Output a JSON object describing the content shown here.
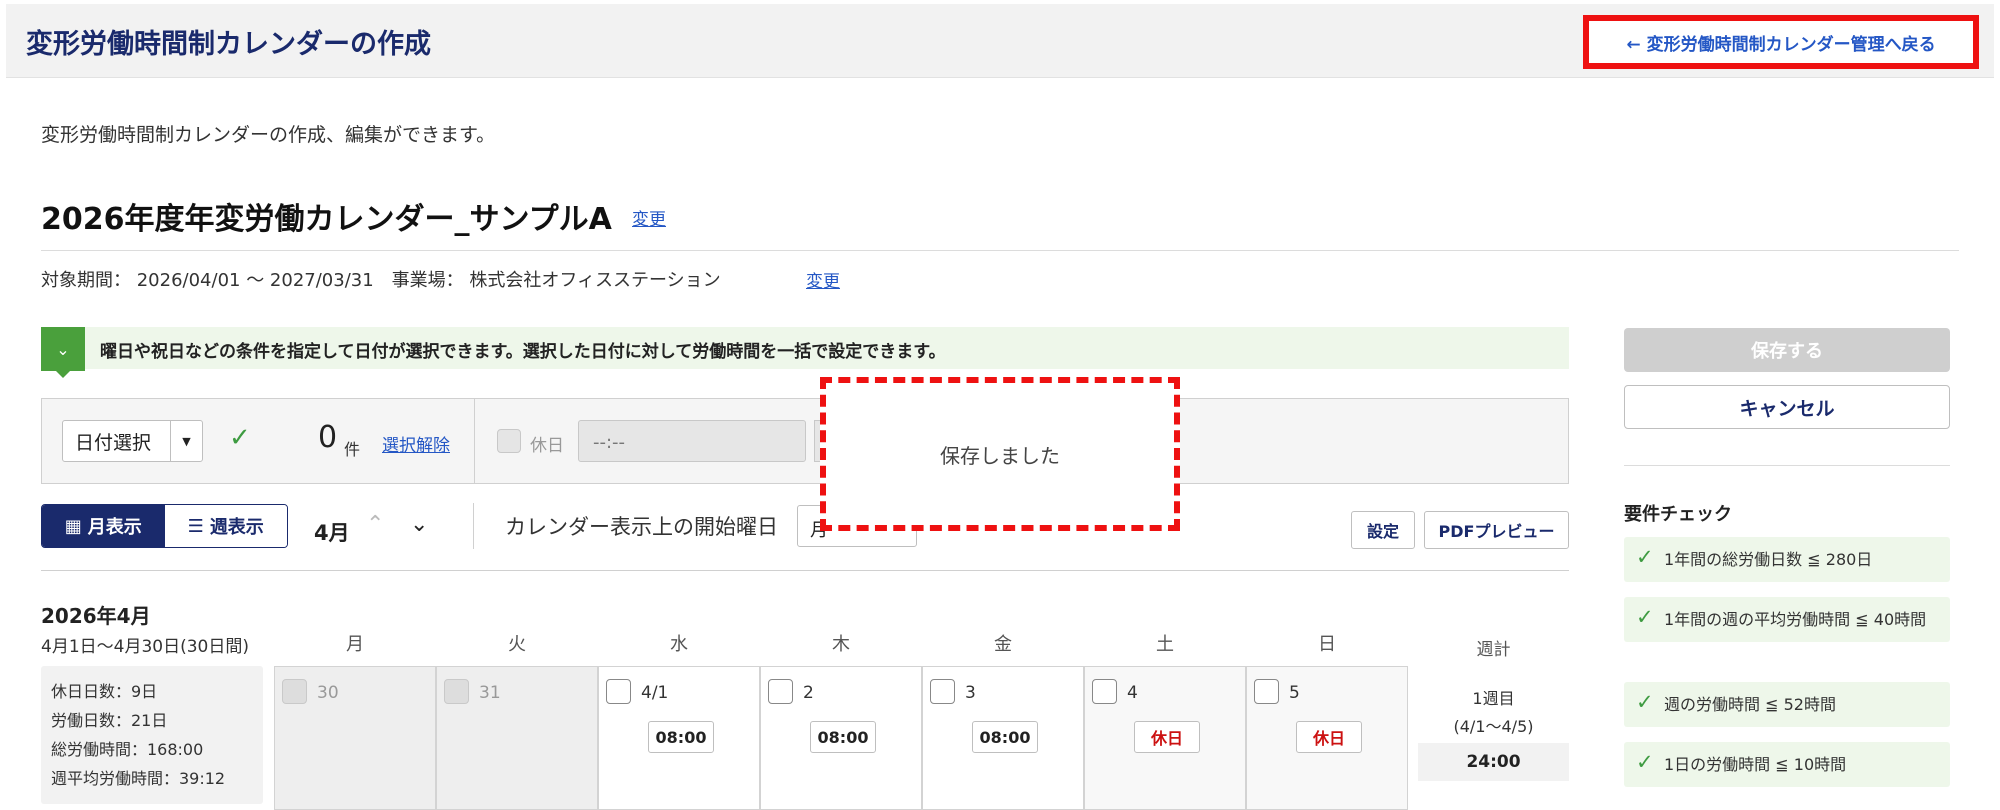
{
  "header": {
    "title": "変形労働時間制カレンダーの作成",
    "back_link": "← 変形労働時間制カレンダー管理へ戻る"
  },
  "description": "変形労働時間制カレンダーの作成、編集ができます。",
  "calendar": {
    "name": "2026年度年変労働カレンダー_サンプルA",
    "change_label": "変更",
    "period_text": "対象期間： 2026/04/01 ～ 2027/03/31　事業場： 株式会社オフィスステーション",
    "period_change_label": "変更"
  },
  "notice": {
    "text": "曜日や祝日などの条件を指定して日付が選択できます。選択した日付に対して労働時間を一括で設定できます。"
  },
  "toolbar": {
    "date_select": "日付選択",
    "count": "0",
    "count_unit": "件",
    "deselect": "選択解除",
    "holiday_label": "休日",
    "time_value": "--:--"
  },
  "view": {
    "month_label": "月表示",
    "week_label": "週表示",
    "current_month": "4月",
    "start_day_label": "カレンダー表示上の開始曜日",
    "start_day_value": "月",
    "settings": "設定",
    "pdf_preview": "PDFプレビュー"
  },
  "month": {
    "title": "2026年4月",
    "range": "4月1日～4月30日(30日間)",
    "stats": [
      "休日日数：9日",
      "労働日数：21日",
      "総労働時間：168:00",
      "週平均労働時間：39:12"
    ]
  },
  "weekdays": [
    "月",
    "火",
    "水",
    "木",
    "金",
    "土",
    "日"
  ],
  "week_total_header": "週計",
  "week1": {
    "days": [
      {
        "num": "30",
        "tag": ""
      },
      {
        "num": "31",
        "tag": ""
      },
      {
        "num": "4/1",
        "tag": "08:00"
      },
      {
        "num": "2",
        "tag": "08:00"
      },
      {
        "num": "3",
        "tag": "08:00"
      },
      {
        "num": "4",
        "tag": "休日"
      },
      {
        "num": "5",
        "tag": "休日"
      }
    ],
    "label_line1": "1週目",
    "label_line2": "(4/1～4/5)",
    "total": "24:00"
  },
  "side": {
    "save": "保存する",
    "cancel": "キャンセル",
    "req_title": "要件チェック",
    "requirements": [
      "1年間の総労働日数 ≦ 280日",
      "1年間の週の平均労働時間 ≦ 40時間",
      "週の労働時間 ≦ 52時間",
      "1日の労働時間 ≦ 10時間"
    ]
  },
  "toast": {
    "message": "保存しました"
  },
  "colors": {
    "navy": "#1a2a6c",
    "link": "#2457c5",
    "green": "#3e9b41",
    "holiday_red": "#cc1111",
    "highlight": "#ee1111"
  }
}
